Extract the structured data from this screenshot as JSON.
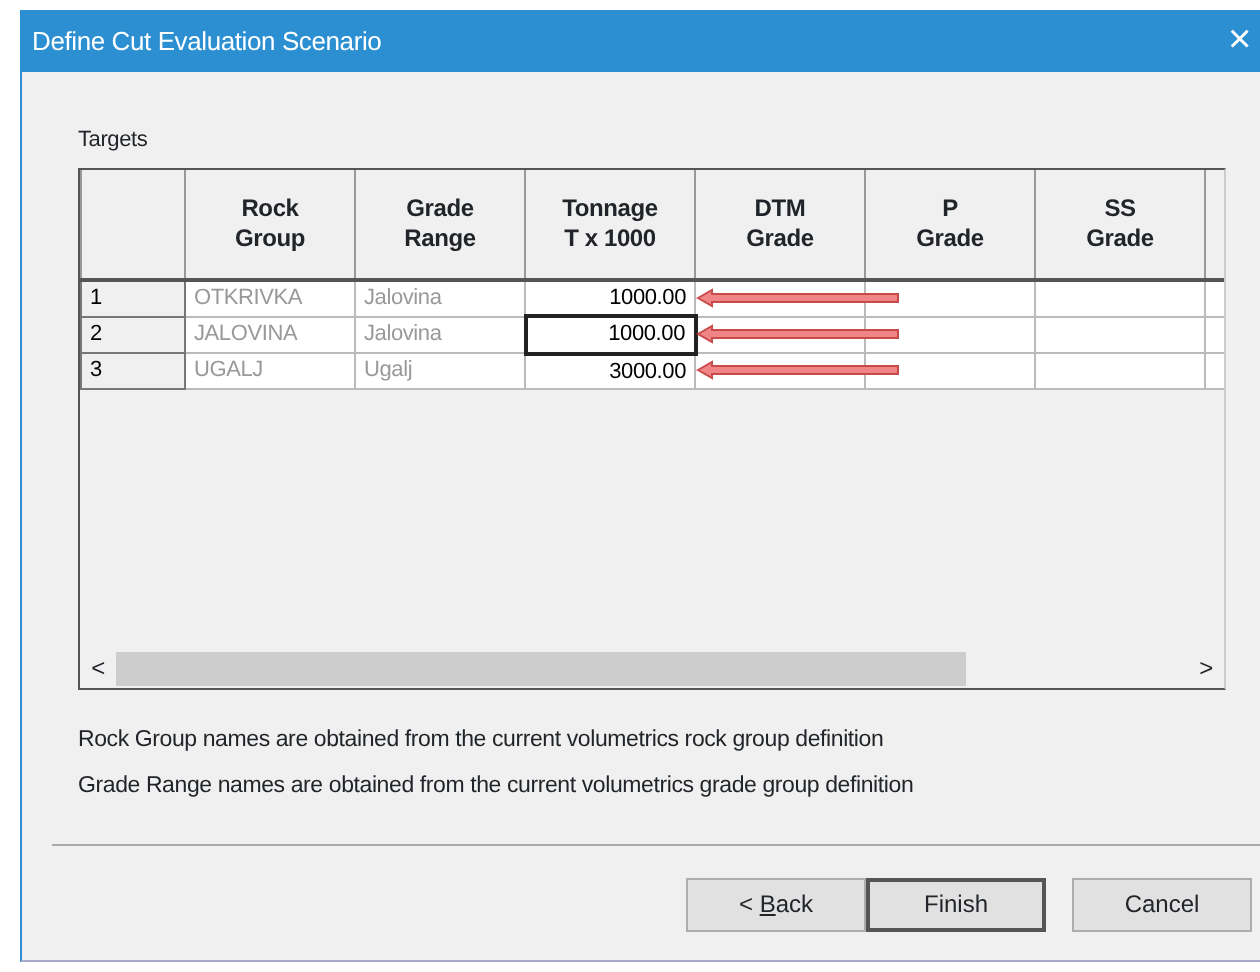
{
  "window": {
    "title": "Define Cut Evaluation Scenario",
    "close": "×"
  },
  "group_label": "Targets",
  "table": {
    "columns": [
      {
        "line1": "Rock",
        "line2": "Group"
      },
      {
        "line1": "Grade",
        "line2": "Range"
      },
      {
        "line1": "Tonnage",
        "line2": "T x 1000"
      },
      {
        "line1": "DTM",
        "line2": "Grade"
      },
      {
        "line1": "P",
        "line2": "Grade"
      },
      {
        "line1": "SS",
        "line2": "Grade"
      }
    ],
    "rows": [
      {
        "number": "1",
        "rock_group": "OTKRIVKA",
        "grade_range": "Jalovina",
        "tonnage": "1000.00",
        "focused": false,
        "arrow": true
      },
      {
        "number": "2",
        "rock_group": "JALOVINA",
        "grade_range": "Jalovina",
        "tonnage": "1000.00",
        "focused": true,
        "arrow": true
      },
      {
        "number": "3",
        "rock_group": "UGALJ",
        "grade_range": "Ugalj",
        "tonnage": "3000.00",
        "focused": false,
        "arrow": true
      }
    ],
    "scrollbar": {
      "left": "<",
      "right": ">"
    }
  },
  "notes": [
    "Rock Group names are obtained from the current volumetrics rock group definition",
    "Grade Range names are obtained from the current volumetrics grade group definition"
  ],
  "buttons": [
    {
      "label_before": "< ",
      "mnemonic": "B",
      "label_after": "ack",
      "default": false
    },
    {
      "label": "Finish",
      "default": true
    },
    {
      "label": "Cancel",
      "default": false
    }
  ]
}
